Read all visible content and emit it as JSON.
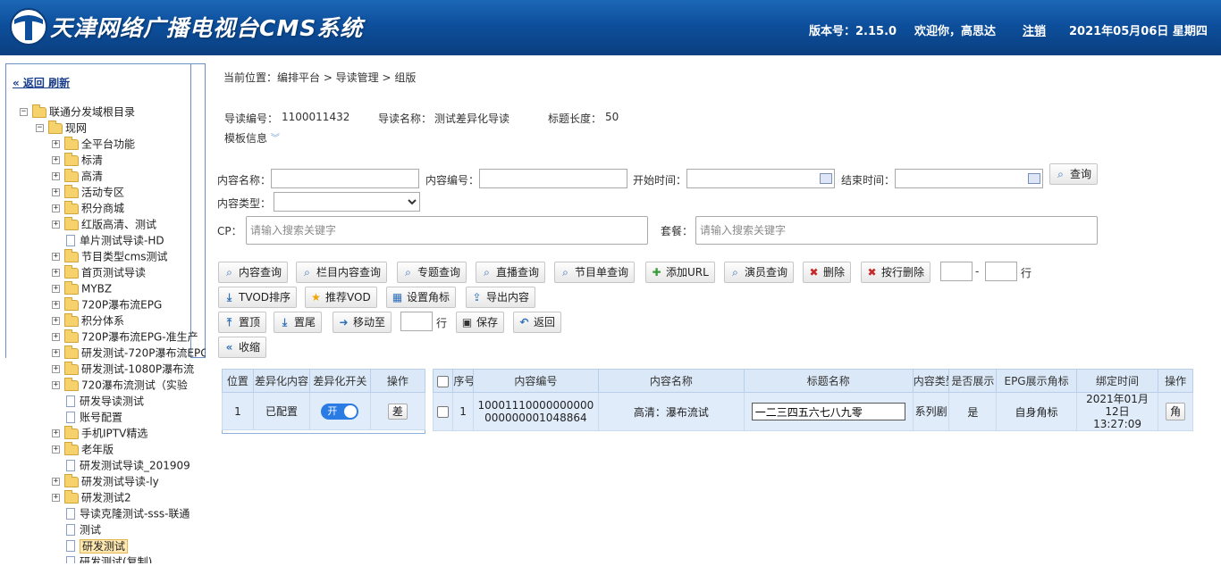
{
  "header": {
    "title": "天津网络广播电视台CMS系统",
    "version": "版本号：2.15.0",
    "welcome": "欢迎你，高思达",
    "logout": "注销",
    "date": "2021年05月06日 星期四",
    "colors": {
      "bar": "#0d4f9c",
      "text": "#ffffff"
    }
  },
  "sidebar": {
    "back": "« 返回",
    "refresh": "刷新",
    "tree": [
      {
        "label": "联通分发域根目录",
        "type": "folder",
        "exp": "-"
      },
      {
        "label": "现网",
        "type": "folder",
        "exp": "-"
      },
      {
        "label": "全平台功能",
        "type": "folder",
        "exp": "+"
      },
      {
        "label": "标清",
        "type": "folder",
        "exp": "+"
      },
      {
        "label": "高清",
        "type": "folder",
        "exp": "+"
      },
      {
        "label": "活动专区",
        "type": "folder",
        "exp": "+"
      },
      {
        "label": "积分商城",
        "type": "folder",
        "exp": "+"
      },
      {
        "label": "红版高清、测试",
        "type": "folder",
        "exp": "+"
      },
      {
        "label": "单片测试导读-HD",
        "type": "doc",
        "exp": ""
      },
      {
        "label": "节目类型cms测试",
        "type": "folder",
        "exp": "+"
      },
      {
        "label": "首页测试导读",
        "type": "folder",
        "exp": "+"
      },
      {
        "label": "MYBZ",
        "type": "folder",
        "exp": "+"
      },
      {
        "label": "720P瀑布流EPG",
        "type": "folder",
        "exp": "+"
      },
      {
        "label": "积分体系",
        "type": "folder",
        "exp": "+"
      },
      {
        "label": "720P瀑布流EPG-准生产",
        "type": "folder",
        "exp": "+"
      },
      {
        "label": "研发测试-720P瀑布流EPG",
        "type": "folder",
        "exp": "+"
      },
      {
        "label": "研发测试-1080P瀑布流",
        "type": "folder",
        "exp": "+"
      },
      {
        "label": "720瀑布流测试（实验",
        "type": "folder",
        "exp": "+"
      },
      {
        "label": "研发导读测试",
        "type": "doc",
        "exp": ""
      },
      {
        "label": "账号配置",
        "type": "doc",
        "exp": ""
      },
      {
        "label": "手机IPTV精选",
        "type": "folder",
        "exp": "+"
      },
      {
        "label": "老年版",
        "type": "folder",
        "exp": "+"
      },
      {
        "label": "研发测试导读_201909",
        "type": "doc",
        "exp": ""
      },
      {
        "label": "研发测试导读-ly",
        "type": "folder",
        "exp": "+"
      },
      {
        "label": "研发测试2",
        "type": "folder",
        "exp": "+"
      },
      {
        "label": "导读克隆测试-sss-联通",
        "type": "doc",
        "exp": ""
      },
      {
        "label": "测试",
        "type": "doc",
        "exp": ""
      },
      {
        "label": "研发测试",
        "type": "doc",
        "exp": "",
        "selected": true
      },
      {
        "label": "研发测试(复制)",
        "type": "doc",
        "exp": ""
      }
    ]
  },
  "breadcrumb": "当前位置：编排平台 > 导读管理 > 组版",
  "info": {
    "code_label": "导读编号：",
    "code": "1100011432",
    "name_label": "导读名称：",
    "name": "测试差异化导读",
    "len_label": "标题长度：",
    "len": "50",
    "template": "模板信息"
  },
  "search": {
    "content_name": "内容名称：",
    "content_code": "内容编号：",
    "start_time": "开始时间：",
    "end_time": "结束时间：",
    "query": "查询",
    "content_type": "内容类型：",
    "cp": "CP：",
    "cp_placeholder": "请输入搜索关键字",
    "pkg": "套餐：",
    "pkg_placeholder": "请输入搜索关键字"
  },
  "toolbar": {
    "row1": [
      {
        "label": "内容查询",
        "icon": "search-icon"
      },
      {
        "label": "栏目内容查询",
        "icon": "search-icon"
      },
      {
        "label": "专题查询",
        "icon": "search-icon"
      },
      {
        "label": "直播查询",
        "icon": "search-icon"
      },
      {
        "label": "节目单查询",
        "icon": "search-icon"
      },
      {
        "label": "添加URL",
        "icon": "add-icon"
      },
      {
        "label": "演员查询",
        "icon": "search-icon"
      },
      {
        "label": "删除",
        "icon": "delete-icon"
      },
      {
        "label": "按行删除",
        "icon": "delete-icon"
      }
    ],
    "row_dash": "-",
    "row_unit": "行",
    "row2": [
      {
        "label": "TVOD排序",
        "icon": "download-icon"
      },
      {
        "label": "推荐VOD",
        "icon": "star-icon"
      },
      {
        "label": "设置角标",
        "icon": "grid-icon"
      },
      {
        "label": "导出内容",
        "icon": "export-icon"
      }
    ],
    "row3": [
      {
        "label": "置顶",
        "icon": "top-icon"
      },
      {
        "label": "置尾",
        "icon": "bottom-icon"
      },
      {
        "label": "移动至",
        "icon": "arrow-right-icon"
      }
    ],
    "move_unit": "行",
    "save": "保存",
    "back": "返回",
    "collapse": "收缩"
  },
  "diff_table": {
    "headers": [
      "位置",
      "差异化内容",
      "差异化开关",
      "操作"
    ],
    "rows": [
      {
        "pos": "1",
        "content": "已配置",
        "switch": "开",
        "op": "差"
      }
    ]
  },
  "content_table": {
    "headers": [
      "序号",
      "内容编号",
      "内容名称",
      "标题名称",
      "内容类型",
      "是否展示",
      "EPG展示角标",
      "绑定时间",
      "操作"
    ],
    "rows": [
      {
        "idx": "1",
        "code": "10001110000000000000000001048864",
        "name": "高清：瀑布流试",
        "title": "一二三四五六七八九零",
        "type": "系列剧",
        "show": "是",
        "epg": "自身角标",
        "time": "2021年01月12日 13:27:09",
        "op": "角"
      }
    ]
  }
}
